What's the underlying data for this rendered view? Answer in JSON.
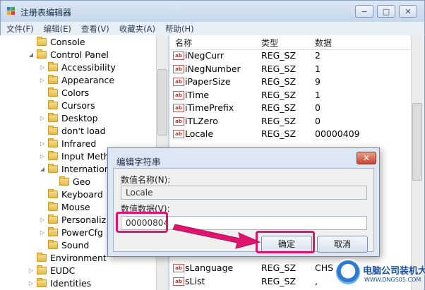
{
  "window": {
    "title": "注册表编辑器",
    "buttons": {
      "minimize": "−",
      "maximize": "□",
      "close": "✕"
    }
  },
  "menu": [
    "文件(F)",
    "编辑(E)",
    "查看(V)",
    "收藏夹(A)",
    "帮助(H)"
  ],
  "tree": [
    {
      "label": "Console",
      "arrow": ""
    },
    {
      "label": "Control Panel",
      "arrow": "◢"
    },
    {
      "label": "Accessibility",
      "arrow": "▷"
    },
    {
      "label": "Appearance",
      "arrow": "▷"
    },
    {
      "label": "Colors",
      "arrow": ""
    },
    {
      "label": "Cursors",
      "arrow": ""
    },
    {
      "label": "Desktop",
      "arrow": "▷"
    },
    {
      "label": "don't load",
      "arrow": ""
    },
    {
      "label": "Infrared",
      "arrow": "▷"
    },
    {
      "label": "Input Meth",
      "arrow": "▷"
    },
    {
      "label": "Internation",
      "arrow": "◢"
    },
    {
      "label": "Geo",
      "arrow": ""
    },
    {
      "label": "Keyboard",
      "arrow": ""
    },
    {
      "label": "Mouse",
      "arrow": ""
    },
    {
      "label": "Personaliz",
      "arrow": "▷"
    },
    {
      "label": "PowerCfg",
      "arrow": "▷"
    },
    {
      "label": "Sound",
      "arrow": ""
    },
    {
      "label": "Environment",
      "arrow": ""
    },
    {
      "label": "EUDC",
      "arrow": "▷"
    },
    {
      "label": "Identities",
      "arrow": "▷"
    }
  ],
  "list": {
    "headers": {
      "name": "名称",
      "type": "类型",
      "data": "数据"
    },
    "rows": [
      {
        "name": "iNegCurr",
        "type": "REG_SZ",
        "data": "2"
      },
      {
        "name": "iNegNumber",
        "type": "REG_SZ",
        "data": "1"
      },
      {
        "name": "iPaperSize",
        "type": "REG_SZ",
        "data": "9"
      },
      {
        "name": "iTime",
        "type": "REG_SZ",
        "data": "1"
      },
      {
        "name": "iTimePrefix",
        "type": "REG_SZ",
        "data": "0"
      },
      {
        "name": "iTLZero",
        "type": "REG_SZ",
        "data": "0"
      },
      {
        "name": "Locale",
        "type": "REG_SZ",
        "data": "00000409"
      }
    ],
    "bottom_rows": [
      {
        "name": "sLanguage",
        "type": "REG_SZ",
        "data": "CHS"
      },
      {
        "name": "sList",
        "type": "REG_SZ",
        "data": ","
      }
    ]
  },
  "dialog": {
    "title": "编辑字符串",
    "close_label": "✕",
    "name_label": "数值名称(N):",
    "name_value": "Locale",
    "data_label": "数值数据(V):",
    "data_value": "00000804",
    "ok_label": "确定",
    "cancel_label": "取消"
  },
  "watermark": {
    "text": "电脑公司装机大师",
    "url": "WWW.DNGS05.COM"
  },
  "colors": {
    "highlight": "#e0146f",
    "accent": "#1c4f9a"
  }
}
